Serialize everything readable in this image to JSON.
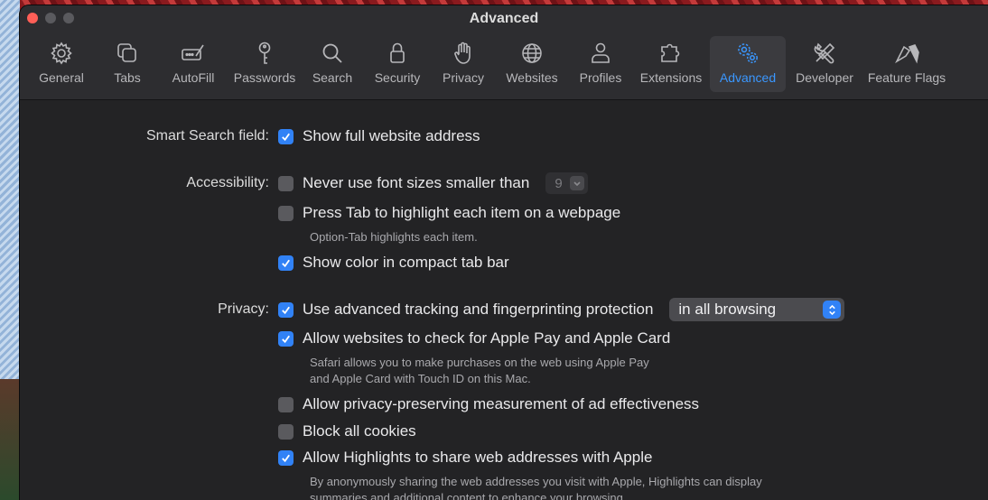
{
  "window": {
    "title": "Advanced"
  },
  "toolbar": {
    "items": [
      {
        "label": "General",
        "icon": "gear-icon"
      },
      {
        "label": "Tabs",
        "icon": "tabs-icon"
      },
      {
        "label": "AutoFill",
        "icon": "autofill-icon"
      },
      {
        "label": "Passwords",
        "icon": "key-icon"
      },
      {
        "label": "Search",
        "icon": "search-icon"
      },
      {
        "label": "Security",
        "icon": "lock-icon"
      },
      {
        "label": "Privacy",
        "icon": "hand-icon"
      },
      {
        "label": "Websites",
        "icon": "globe-icon"
      },
      {
        "label": "Profiles",
        "icon": "person-icon"
      },
      {
        "label": "Extensions",
        "icon": "puzzle-icon"
      },
      {
        "label": "Advanced",
        "icon": "gears-icon"
      },
      {
        "label": "Developer",
        "icon": "tools-icon"
      },
      {
        "label": "Feature Flags",
        "icon": "flags-icon"
      }
    ],
    "active": "Advanced",
    "accent": "#3a97ff"
  },
  "settings": {
    "smart_search": {
      "label": "Smart Search field:",
      "show_full_address": {
        "text": "Show full website address",
        "checked": true
      }
    },
    "accessibility": {
      "label": "Accessibility:",
      "min_font": {
        "text": "Never use font sizes smaller than",
        "checked": false,
        "value": "9"
      },
      "press_tab": {
        "text": "Press Tab to highlight each item on a webpage",
        "checked": false,
        "note": "Option-Tab highlights each item."
      },
      "compact_color": {
        "text": "Show color in compact tab bar",
        "checked": true
      }
    },
    "privacy": {
      "label": "Privacy:",
      "tracking": {
        "text": "Use advanced tracking and fingerprinting protection",
        "checked": true,
        "selected": "in all browsing"
      },
      "apple_pay": {
        "text": "Allow websites to check for Apple Pay and Apple Card",
        "checked": true,
        "note_line1": "Safari allows you to make purchases on the web using Apple Pay",
        "note_line2": "and Apple Card with Touch ID on this Mac."
      },
      "ad_measurement": {
        "text": "Allow privacy-preserving measurement of ad effectiveness",
        "checked": false
      },
      "block_cookies": {
        "text": "Block all cookies",
        "checked": false
      },
      "highlights": {
        "text": "Allow Highlights to share web addresses with Apple",
        "checked": true,
        "note_line1": "By anonymously sharing the web addresses you visit with Apple, Highlights can display",
        "note_line2": "summaries and additional content to enhance your browsing."
      }
    }
  },
  "colors": {
    "checkbox_on": "#3182f6",
    "close_button": "#ff5f57"
  }
}
